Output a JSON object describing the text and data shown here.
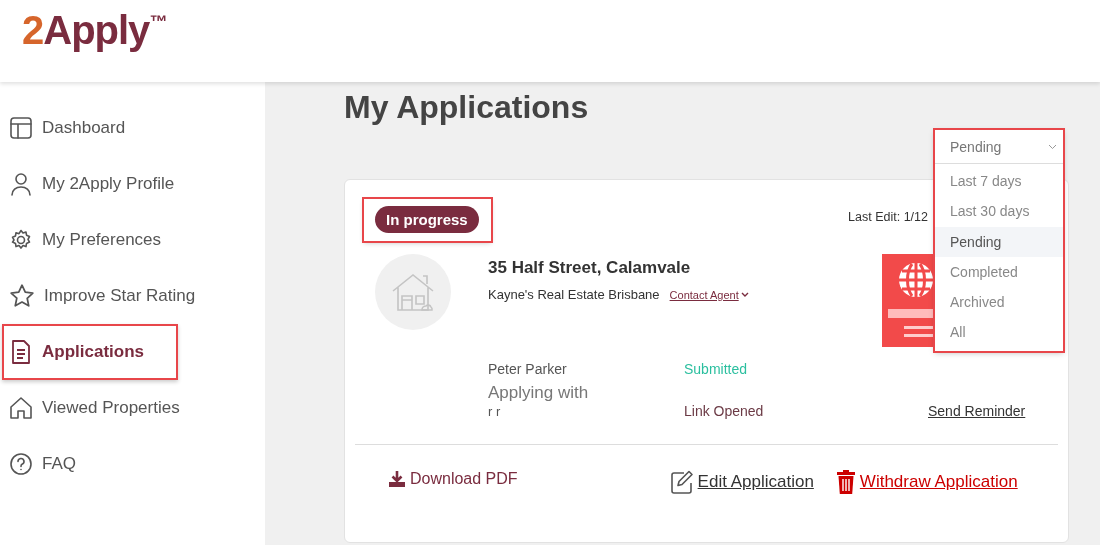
{
  "logo": {
    "lead": "2",
    "rest": "Apply",
    "mark": "™"
  },
  "sidebar": {
    "items": [
      {
        "label": "Dashboard",
        "selected": false,
        "highlighted": false
      },
      {
        "label": "My 2Apply Profile",
        "selected": false,
        "highlighted": false
      },
      {
        "label": "My Preferences",
        "selected": false,
        "highlighted": false
      },
      {
        "label": "Improve Star Rating",
        "selected": false,
        "highlighted": false
      },
      {
        "label": "Applications",
        "selected": true,
        "highlighted": true
      },
      {
        "label": "Viewed Properties",
        "selected": false,
        "highlighted": false
      },
      {
        "label": "FAQ",
        "selected": false,
        "highlighted": false
      }
    ]
  },
  "page_title": "My Applications",
  "filter": {
    "value": "Pending",
    "expanded": true,
    "highlighted": true,
    "options": [
      {
        "label": "Last 7 days",
        "selected": false
      },
      {
        "label": "Last 30 days",
        "selected": false
      },
      {
        "label": "Pending",
        "selected": true
      },
      {
        "label": "Completed",
        "selected": false
      },
      {
        "label": "Archived",
        "selected": false
      },
      {
        "label": "All",
        "selected": false
      }
    ]
  },
  "application": {
    "status": "In progress",
    "status_highlighted": true,
    "last_edit": "Last Edit: 1/12",
    "address": "35 Half Street, Calamvale",
    "agency": "Kayne's Real Estate Brisbane",
    "contact_link": "Contact Agent",
    "applicants": [
      {
        "name": "Peter Parker",
        "status": "Submitted",
        "kind": "submitted"
      }
    ],
    "applying_with_label": "Applying with",
    "co_applicants": [
      {
        "name": "r r",
        "status": "Link Opened",
        "kind": "opened",
        "reminder": "Send Reminder"
      }
    ],
    "download_link": "Download PDF",
    "edit_link": "Edit Application",
    "withdraw_link": "Withdraw Application"
  }
}
